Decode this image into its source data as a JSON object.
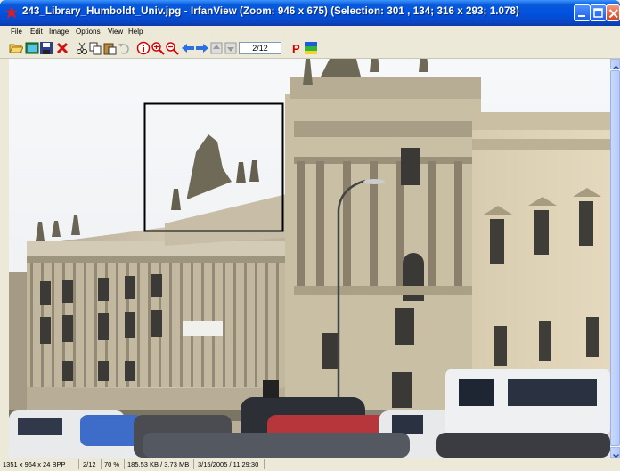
{
  "window": {
    "title": "243_Library_Humboldt_Univ.jpg - IrfanView (Zoom: 946 x 675) (Selection: 301 , 134; 316 x 293; 1.078)"
  },
  "menu": {
    "items": [
      "File",
      "Edit",
      "Image",
      "Options",
      "View",
      "Help"
    ]
  },
  "toolbar": {
    "tools": [
      "open-icon",
      "thumbnails-icon",
      "save-icon",
      "delete-icon",
      "cut-icon",
      "copy-icon",
      "paste-icon",
      "undo-icon",
      "info-icon",
      "zoom-in-icon",
      "zoom-out-icon",
      "previous-icon",
      "next-icon",
      "first-page-icon",
      "last-page-icon",
      "print-icon",
      "properties-icon"
    ],
    "page_value": "2/12"
  },
  "image": {
    "description_icon": "photo-canvas"
  },
  "status": {
    "resolution": "1351 x 964 x 24 BPP",
    "page": "2/12",
    "zoom": "70 %",
    "filesize": "185.53 KB / 3.73 MB",
    "datetime": "3/15/2005 / 11:29:30"
  },
  "colors": {
    "title_blue": "#0052e0",
    "chrome": "#ece9d8",
    "selection": "#000000"
  }
}
